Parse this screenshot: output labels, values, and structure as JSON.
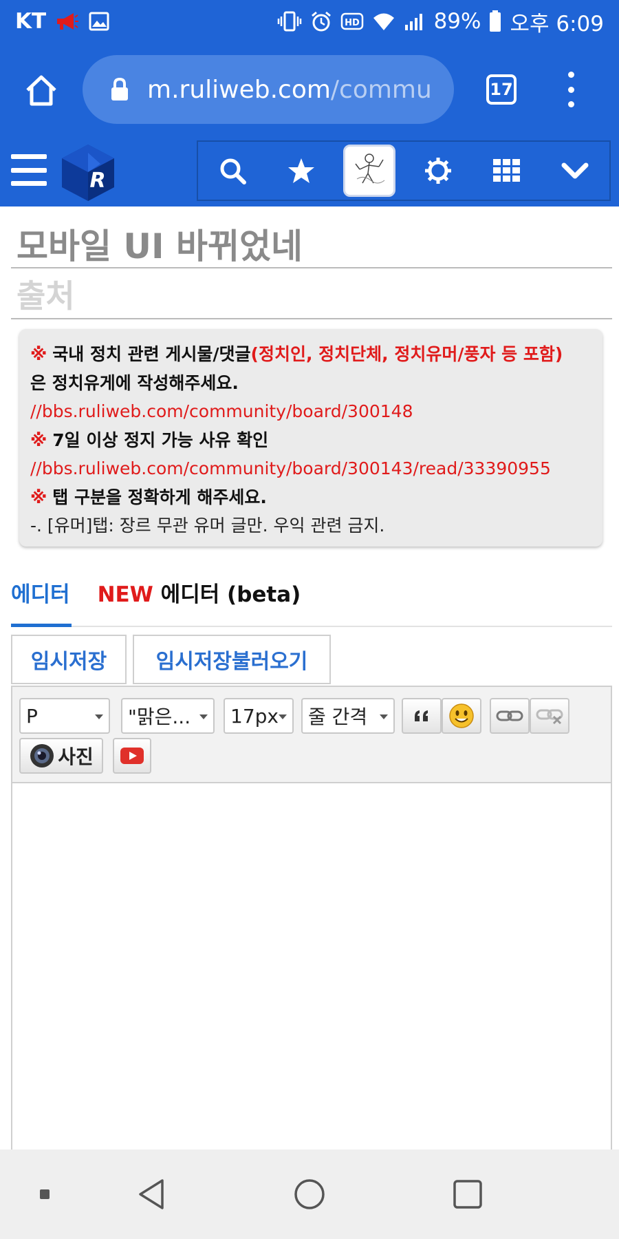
{
  "status_bar": {
    "carrier": "KT",
    "battery": "89%",
    "time": "오후 6:09",
    "color": "#1f64d6"
  },
  "browser": {
    "url_host": "m.ruliweb.com",
    "url_path": "/commu",
    "tab_count": "17"
  },
  "post": {
    "title": "모바일 UI 바뀌었네",
    "source_placeholder": "출처"
  },
  "notice": {
    "mark": "※",
    "line1_bold": "국내 정치 관련 게시물/댓글",
    "line1_red": "(정치인, 정치단체, 정치유머/풍자 등 포함)",
    "line2": "은 정치유게에 작성해주세요.",
    "link1": "//bbs.ruliweb.com/community/board/300148",
    "line3": "7일 이상 정지 가능 사유 확인",
    "link2": "//bbs.ruliweb.com/community/board/300143/read/33390955",
    "line4": "탭 구분을 정확하게 해주세요.",
    "line5": "-. [유머]탭: 장르 무관 유머 글만. 우익 관련 금지."
  },
  "editor_tabs": {
    "tab1": "에디터",
    "tab2_new": "NEW",
    "tab2_rest": " 에디터 (beta)"
  },
  "temp": {
    "save": "임시저장",
    "load": "임시저장불러오기"
  },
  "toolbar": {
    "format": "P",
    "font": "\"맑은...",
    "size": "17px",
    "line_height": "줄 간격",
    "photo": "사진"
  },
  "icons": {
    "lock": "lock-icon",
    "home": "home-icon",
    "search": "search-icon",
    "star": "star-icon",
    "gear": "gear-icon",
    "grid": "grid-icon",
    "chevron": "chevron-down-icon"
  }
}
